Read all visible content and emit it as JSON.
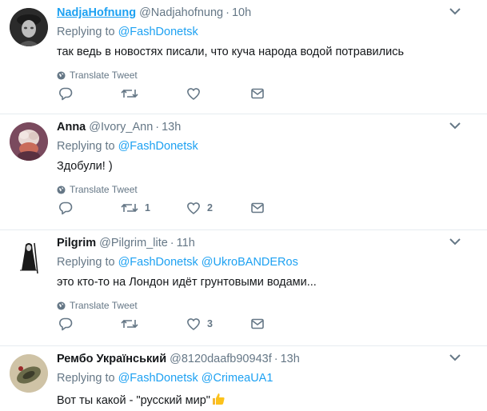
{
  "tweets": [
    {
      "name": "NadjaHofnung",
      "handle": "@Nadjahofnung",
      "time": "10h",
      "replying_prefix": "Replying to",
      "mentions": [
        "@FashDonetsk"
      ],
      "text": "так ведь в новостях писали, что куча народа водой потравились",
      "translate": "Translate Tweet",
      "retweets": "",
      "likes": ""
    },
    {
      "name": "Anna",
      "handle": "@Ivory_Ann",
      "time": "13h",
      "replying_prefix": "Replying to",
      "mentions": [
        "@FashDonetsk"
      ],
      "text": "Здобули! )",
      "translate": "Translate Tweet",
      "retweets": "1",
      "likes": "2"
    },
    {
      "name": "Pilgrim",
      "handle": "@Pilgrim_lite",
      "time": "11h",
      "replying_prefix": "Replying to",
      "mentions": [
        "@FashDonetsk",
        "@UkroBANDERos"
      ],
      "text": "это кто-то на Лондон идёт грунтовыми водами...",
      "translate": "Translate Tweet",
      "retweets": "",
      "likes": "3"
    },
    {
      "name": "Рембо Український",
      "handle": "@8120daafb90943f",
      "time": "13h",
      "replying_prefix": "Replying to",
      "mentions": [
        "@FashDonetsk",
        "@CrimeaUA1"
      ],
      "text": "Вот ты какой - \"русский мир\"",
      "translate": "",
      "retweets": "",
      "likes": ""
    }
  ],
  "separator": "·",
  "colors": {
    "link": "#1da1f2",
    "muted": "#657786",
    "text": "#14171a",
    "border": "#e6ecf0"
  },
  "icons": [
    "reply-icon",
    "retweet-icon",
    "like-icon",
    "message-icon",
    "caret-down-icon",
    "globe-icon",
    "thumbs-up-emoji"
  ]
}
